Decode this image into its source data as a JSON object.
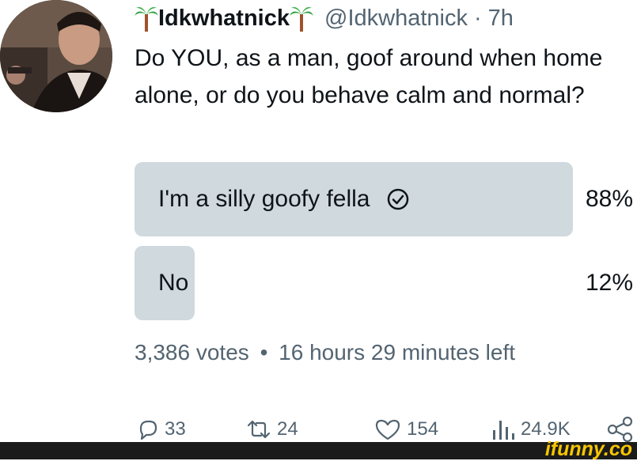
{
  "author": {
    "display_name": "Idkwhatnick",
    "handle": "@Idkwhatnick",
    "time": "7h",
    "separator": "·"
  },
  "tweet": {
    "text": "Do YOU, as a man, goof around when home alone, or do you behave calm and normal?"
  },
  "poll": {
    "options": [
      {
        "label": "I'm a silly goofy fella",
        "percent_text": "88%",
        "percent": 88,
        "selected": true
      },
      {
        "label": "No",
        "percent_text": "12%",
        "percent": 12,
        "selected": false
      }
    ],
    "votes": "3,386 votes",
    "dot": "•",
    "time_left": "16 hours 29 minutes left"
  },
  "actions": {
    "replies": "33",
    "retweets": "24",
    "likes": "154",
    "views": "24.9K"
  },
  "watermark": {
    "text": "ifunny.co"
  },
  "colors": {
    "bar": "#cfd9de",
    "secondary_text": "#536471",
    "watermark": "#f7c600"
  }
}
